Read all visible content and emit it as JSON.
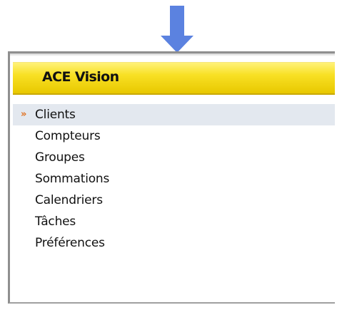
{
  "panel": {
    "title": "ACE Vision",
    "header_color": "#f8e024"
  },
  "menu": {
    "active_index": 0,
    "bullet_icon": "double-chevron-right-icon",
    "bullet_glyph": "»",
    "bullet_color": "#e07020",
    "items": [
      {
        "label": "Clients"
      },
      {
        "label": "Compteurs"
      },
      {
        "label": "Groupes"
      },
      {
        "label": "Sommations"
      },
      {
        "label": "Calendriers"
      },
      {
        "label": "Tâches"
      },
      {
        "label": "Préférences"
      }
    ]
  },
  "arrow": {
    "icon": "arrow-down-icon",
    "color": "#5b82e0"
  }
}
